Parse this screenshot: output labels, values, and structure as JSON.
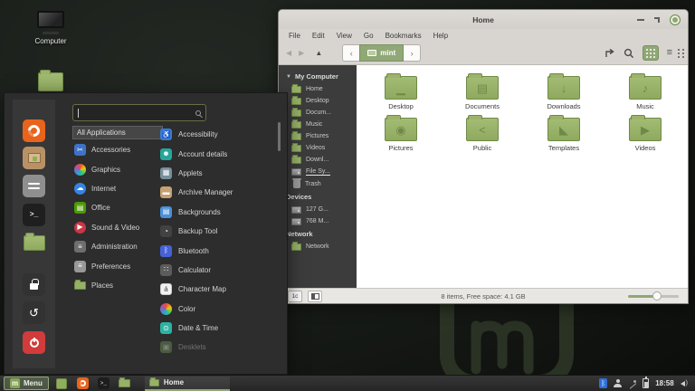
{
  "colors": {
    "accent_green": "#8fa876",
    "folder_green": "#97b168",
    "menu_bg": "#2d2d2d",
    "taskbar_bg": "#2e2e2e",
    "close_button": "#8fa871"
  },
  "desktop": {
    "computer_label": "Computer"
  },
  "mint_menu": {
    "search": {
      "placeholder": ""
    },
    "all_applications_label": "All Applications",
    "favorites": [
      {
        "name": "firefox",
        "bg": "#e8641c"
      },
      {
        "name": "software-manager",
        "bg": "#b99167"
      },
      {
        "name": "system-settings",
        "bg": "#8f8f8f"
      },
      {
        "name": "terminal",
        "bg": "#1f1f1f"
      },
      {
        "name": "files",
        "bg": "transparent"
      },
      {
        "name": "lock-screen",
        "bg": "#323232"
      },
      {
        "name": "logout",
        "bg": "#323232"
      },
      {
        "name": "shutdown",
        "bg": "#d13b3b"
      }
    ],
    "categories": [
      {
        "label": "Accessories",
        "glyph": "✂",
        "bg": "#3d73c8",
        "shape": "rounded"
      },
      {
        "label": "Graphics",
        "glyph": "",
        "bg": "conic",
        "shape": "circle"
      },
      {
        "label": "Internet",
        "glyph": "☁",
        "bg": "#3584e4",
        "shape": "circle"
      },
      {
        "label": "Office",
        "glyph": "▤",
        "bg": "#4e9a06",
        "shape": "rounded"
      },
      {
        "label": "Sound & Video",
        "glyph": "▶",
        "bg": "#cc3545",
        "shape": "circle"
      },
      {
        "label": "Administration",
        "glyph": "≡",
        "bg": "#6e6e6e",
        "shape": "rounded"
      },
      {
        "label": "Preferences",
        "glyph": "≡",
        "bg": "#989898",
        "shape": "rounded"
      },
      {
        "label": "Places",
        "glyph": "",
        "bg": "folder",
        "shape": "folder"
      }
    ],
    "applications": [
      {
        "label": "Accessibility",
        "glyph": "♿",
        "bg": "#3b7cce"
      },
      {
        "label": "Account details",
        "glyph": "☻",
        "bg": "#26a69a"
      },
      {
        "label": "Applets",
        "glyph": "▦",
        "bg": "#78909c"
      },
      {
        "label": "Archive Manager",
        "glyph": "▬",
        "bg": "#c5a173"
      },
      {
        "label": "Backgrounds",
        "glyph": "▤",
        "bg": "#4a90d9"
      },
      {
        "label": "Backup Tool",
        "glyph": "◔",
        "bg": "#424242"
      },
      {
        "label": "Bluetooth",
        "glyph": "ᛒ",
        "bg": "#4662d7"
      },
      {
        "label": "Calculator",
        "glyph": "∷",
        "bg": "#5c5c5c"
      },
      {
        "label": "Character Map",
        "glyph": "á",
        "bg": "#f2f2f2",
        "fg": "#444444"
      },
      {
        "label": "Color",
        "glyph": "",
        "bg": "conic"
      },
      {
        "label": "Date & Time",
        "glyph": "⊙",
        "bg": "#2bb3a3"
      },
      {
        "label": "Desklets",
        "glyph": "▣",
        "bg": "#7aa25c",
        "faded": true
      }
    ]
  },
  "file_manager": {
    "title": "Home",
    "menubar": [
      "File",
      "Edit",
      "View",
      "Go",
      "Bookmarks",
      "Help"
    ],
    "toolbar": {
      "breadcrumb": "mint"
    },
    "sidebar": {
      "sections": [
        {
          "header": "My Computer",
          "expander": true,
          "items": [
            {
              "label": "Home",
              "icon": "folder"
            },
            {
              "label": "Desktop",
              "icon": "folder"
            },
            {
              "label": "Docum...",
              "icon": "folder"
            },
            {
              "label": "Music",
              "icon": "folder"
            },
            {
              "label": "Pictures",
              "icon": "folder"
            },
            {
              "label": "Videos",
              "icon": "folder"
            },
            {
              "label": "Downl...",
              "icon": "folder"
            },
            {
              "label": "File Sy...",
              "icon": "drive",
              "underline": true
            },
            {
              "label": "Trash",
              "icon": "trash"
            }
          ]
        },
        {
          "header": "Devices",
          "items": [
            {
              "label": "127 G...",
              "icon": "drive"
            },
            {
              "label": "768 M...",
              "icon": "drive"
            }
          ]
        },
        {
          "header": "Network",
          "items": [
            {
              "label": "Network",
              "icon": "folder"
            }
          ]
        }
      ]
    },
    "folders": [
      {
        "label": "Desktop",
        "glyph": "▁"
      },
      {
        "label": "Documents",
        "glyph": "▤"
      },
      {
        "label": "Downloads",
        "glyph": "↓"
      },
      {
        "label": "Music",
        "glyph": "♪"
      },
      {
        "label": "Pictures",
        "glyph": "◉"
      },
      {
        "label": "Public",
        "glyph": "<"
      },
      {
        "label": "Templates",
        "glyph": "◣"
      },
      {
        "label": "Videos",
        "glyph": "▶"
      }
    ],
    "statusbar": {
      "toggle1": "1c",
      "text": "8 items, Free space: 4.1 GB",
      "zoom_percent": 60
    }
  },
  "taskbar": {
    "menu_button": "Menu",
    "window_button": "Home",
    "clock": "18:58"
  }
}
